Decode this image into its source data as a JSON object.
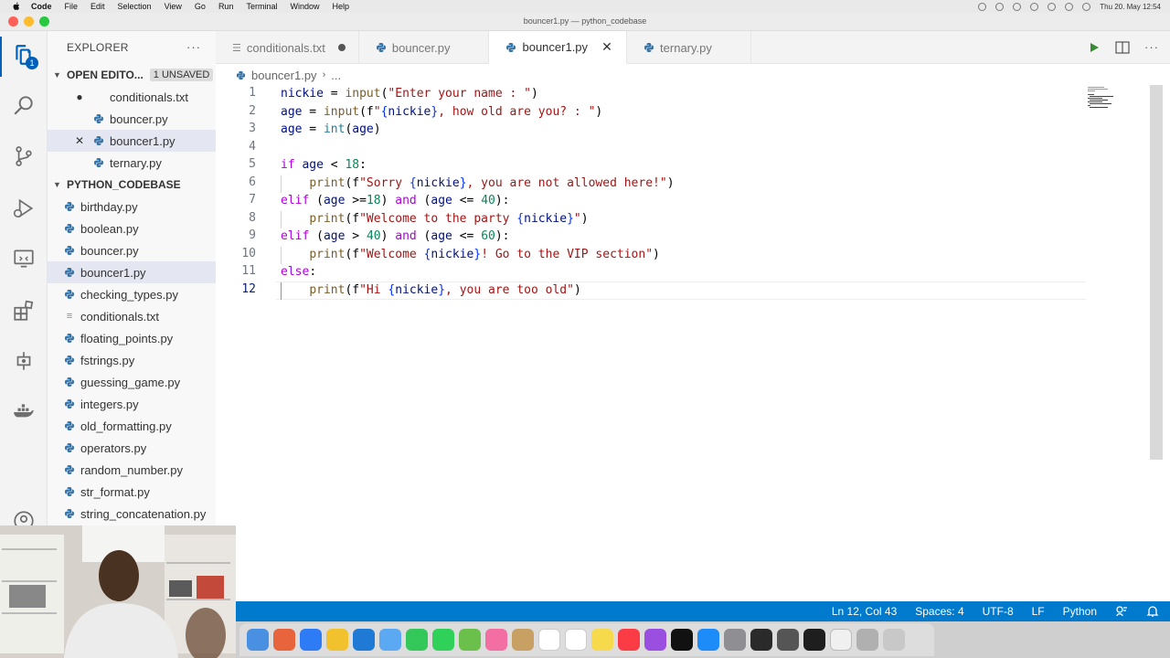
{
  "menubar": {
    "app": "Code",
    "items": [
      "File",
      "Edit",
      "Selection",
      "View",
      "Go",
      "Run",
      "Terminal",
      "Window",
      "Help"
    ],
    "clock": "Thu 20. May  12:54"
  },
  "window": {
    "title": "bouncer1.py — python_codebase"
  },
  "activity": {
    "explorer_badge": "1"
  },
  "sidebar": {
    "title": "EXPLORER",
    "more": "···",
    "open_editors": {
      "label": "OPEN EDITO...",
      "unsaved": "1 UNSAVED",
      "items": [
        {
          "name": "conditionals.txt",
          "mark": "●",
          "type": "txt"
        },
        {
          "name": "bouncer.py",
          "mark": "",
          "type": "py"
        },
        {
          "name": "bouncer1.py",
          "mark": "✕",
          "type": "py"
        },
        {
          "name": "ternary.py",
          "mark": "",
          "type": "py"
        }
      ]
    },
    "folder": {
      "label": "PYTHON_CODEBASE",
      "items": [
        {
          "name": "birthday.py",
          "type": "py"
        },
        {
          "name": "boolean.py",
          "type": "py"
        },
        {
          "name": "bouncer.py",
          "type": "py"
        },
        {
          "name": "bouncer1.py",
          "type": "py"
        },
        {
          "name": "checking_types.py",
          "type": "py"
        },
        {
          "name": "conditionals.txt",
          "type": "txt"
        },
        {
          "name": "floating_points.py",
          "type": "py"
        },
        {
          "name": "fstrings.py",
          "type": "py"
        },
        {
          "name": "guessing_game.py",
          "type": "py"
        },
        {
          "name": "integers.py",
          "type": "py"
        },
        {
          "name": "old_formatting.py",
          "type": "py"
        },
        {
          "name": "operators.py",
          "type": "py"
        },
        {
          "name": "random_number.py",
          "type": "py"
        },
        {
          "name": "str_format.py",
          "type": "py"
        },
        {
          "name": "string_concatenation.py",
          "type": "py"
        }
      ]
    }
  },
  "tabs": [
    {
      "label": "conditionals.txt",
      "type": "txt",
      "state": "unsaved"
    },
    {
      "label": "bouncer.py",
      "type": "py",
      "state": ""
    },
    {
      "label": "bouncer1.py",
      "type": "py",
      "state": "active"
    },
    {
      "label": "ternary.py",
      "type": "py",
      "state": ""
    }
  ],
  "breadcrumb": {
    "file": "bouncer1.py",
    "more": "..."
  },
  "editor": {
    "line_numbers": [
      "1",
      "2",
      "3",
      "4",
      "5",
      "6",
      "7",
      "8",
      "9",
      "10",
      "11",
      "12"
    ],
    "lines": [
      "nickie = input(\"Enter your name : \")",
      "age = input(f\"{nickie}, how old are you? : \")",
      "age = int(age)",
      "",
      "if age < 18:",
      "    print(f\"Sorry {nickie}, you are not allowed here!\")",
      "elif (age >=18) and (age <= 40):",
      "    print(f\"Welcome to the party {nickie}\")",
      "elif (age > 40) and (age <= 60):",
      "    print(f\"Welcome {nickie}! Go to the VIP section\")",
      "else:",
      "    print(f\"Hi {nickie}, you are too old\")"
    ]
  },
  "statusbar": {
    "position": "Ln 12, Col 43",
    "spaces": "Spaces: 4",
    "encoding": "UTF-8",
    "eol": "LF",
    "language": "Python"
  },
  "colors": {
    "accent": "#005fb8",
    "statusbar": "#007acc",
    "keyword": "#af00db",
    "function": "#795e26",
    "string": "#a31515",
    "number": "#098658"
  }
}
